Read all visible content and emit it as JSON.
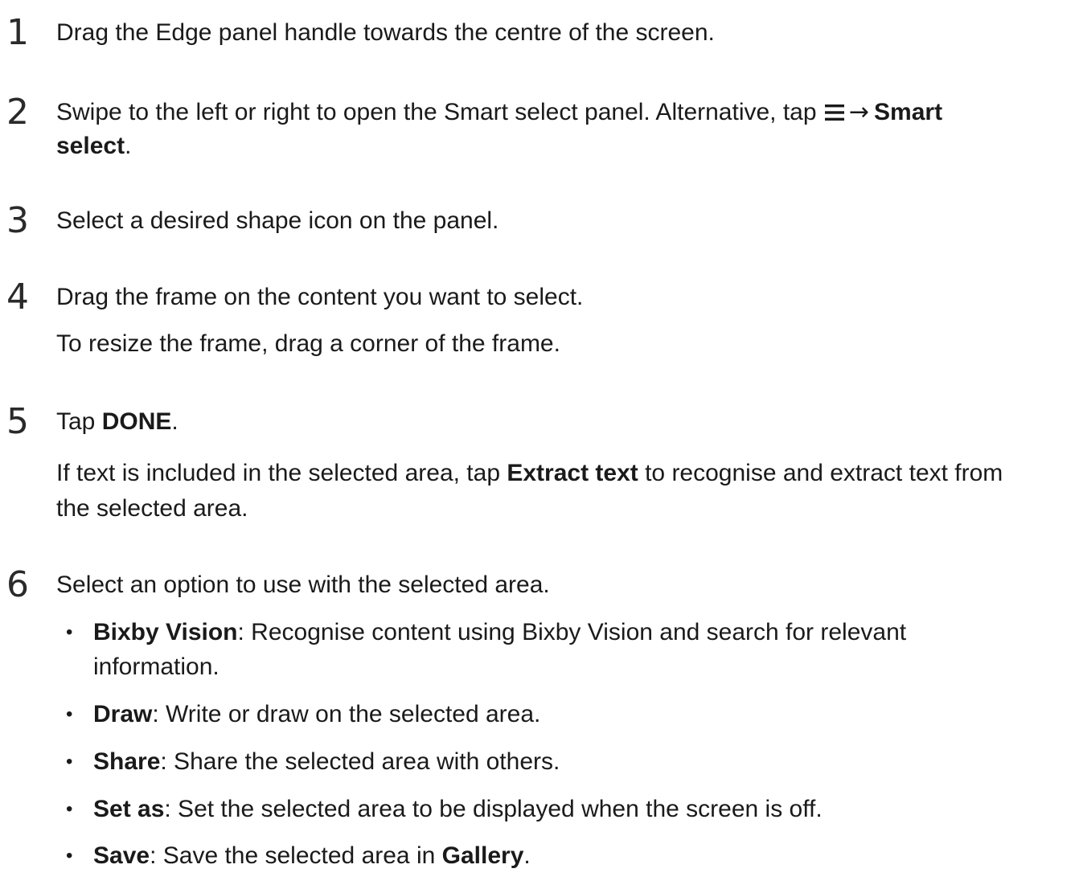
{
  "steps": [
    {
      "number": "1",
      "text": "Drag the Edge panel handle towards the centre of the screen."
    },
    {
      "number": "2",
      "text_a": "Swipe to the left or right to open the Smart select panel. Alternative, tap",
      "menu_icon": "menu-icon",
      "arrow": "→",
      "text_bold_a": "Smart",
      "text_bold_b": "select",
      "text_end": "."
    },
    {
      "number": "3",
      "text": "Select a desired shape icon on the panel."
    },
    {
      "number": "4",
      "text": "Drag the frame on the content you want to select.",
      "note": "To resize the frame, drag a corner of the frame."
    },
    {
      "number": "5",
      "text_pre": "Tap ",
      "text_bold": "DONE",
      "text_end": ".",
      "note_pre": "If text is included in the selected area, tap ",
      "note_bold": "Extract text",
      "note_post": " to recognise and extract text from",
      "note_line2": "the selected area."
    },
    {
      "number": "6",
      "text": "Select an option to use with the selected area.",
      "options": [
        {
          "bullet": "•",
          "label": "Bixby Vision",
          "desc": ": Recognise content using Bixby Vision and search for relevant",
          "desc_line2": "information."
        },
        {
          "bullet": "•",
          "label": "Draw",
          "desc": ": Write or draw on the selected area."
        },
        {
          "bullet": "•",
          "label": "Share",
          "desc": ": Share the selected area with others."
        },
        {
          "bullet": "•",
          "label": "Set as",
          "desc": ": Set the selected area to be displayed when the screen is off."
        },
        {
          "bullet": "•",
          "label": "Save",
          "desc": ": Save the selected area in ",
          "desc_bold": "Gallery",
          "desc_end": "."
        }
      ]
    }
  ]
}
